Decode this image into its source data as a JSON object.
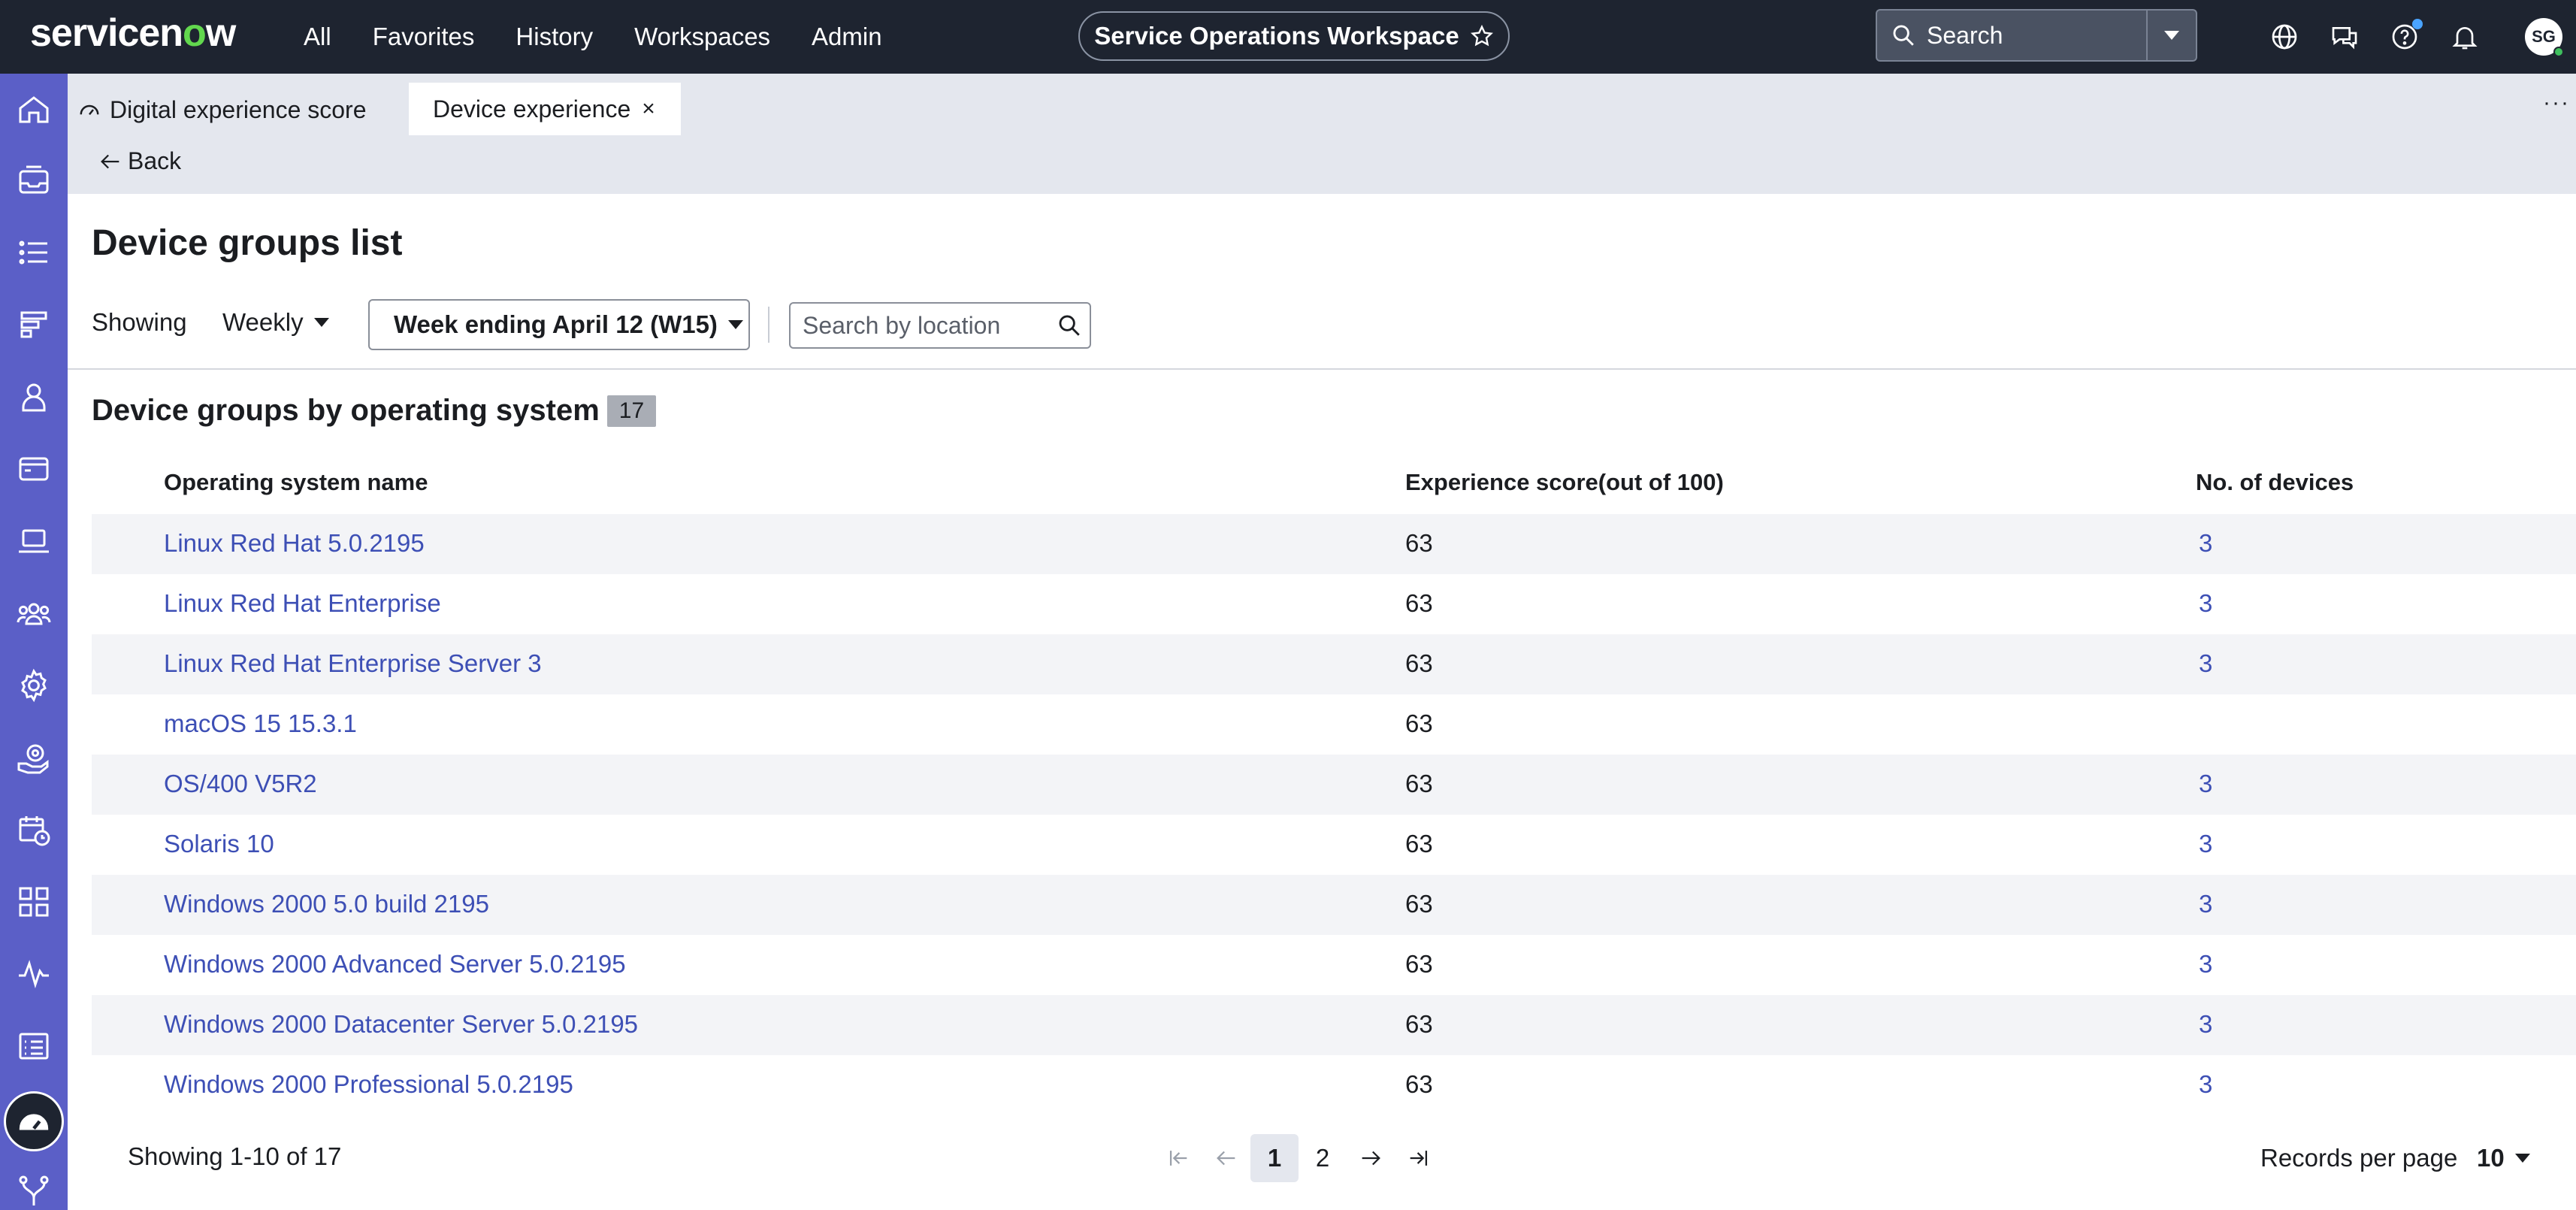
{
  "topbar": {
    "logo": "servicenow",
    "nav": [
      "All",
      "Favorites",
      "History",
      "Workspaces",
      "Admin"
    ],
    "workspace_title": "Service Operations Workspace",
    "search_placeholder": "Search",
    "avatar_initials": "SG"
  },
  "tabs": {
    "tab1": "Digital experience score",
    "tab2": "Device experience"
  },
  "back_label": "Back",
  "page_title": "Device groups list",
  "filters": {
    "showing_label": "Showing",
    "period": "Weekly",
    "week": "Week ending April 12 (W15)",
    "location_placeholder": "Search by location"
  },
  "section": {
    "title": "Device groups by operating system",
    "count": "17"
  },
  "table": {
    "columns": [
      "Operating system name",
      "Experience score(out of 100)",
      "No. of devices"
    ],
    "rows": [
      [
        "Linux Red Hat 5.0.2195",
        "63",
        "3"
      ],
      [
        "Linux Red Hat Enterprise",
        "63",
        "3"
      ],
      [
        "Linux Red Hat Enterprise Server 3",
        "63",
        "3"
      ],
      [
        "macOS 15 15.3.1",
        "63",
        ""
      ],
      [
        "OS/400 V5R2",
        "63",
        "3"
      ],
      [
        "Solaris 10",
        "63",
        "3"
      ],
      [
        "Windows 2000 5.0 build 2195",
        "63",
        "3"
      ],
      [
        "Windows 2000 Advanced Server 5.0.2195",
        "63",
        "3"
      ],
      [
        "Windows 2000 Datacenter Server 5.0.2195",
        "63",
        "3"
      ],
      [
        "Windows 2000 Professional 5.0.2195",
        "63",
        "3"
      ]
    ]
  },
  "pagination": {
    "summary": "Showing 1-10 of 17",
    "pages": [
      "1",
      "2"
    ],
    "current_page": "1",
    "rpp_label": "Records per page",
    "rpp_value": "10"
  },
  "colors": {
    "topbar": "#1e2430",
    "sidebar": "#5b5fc7",
    "link": "#3d4fb5",
    "logo_accent": "#62d84e"
  }
}
